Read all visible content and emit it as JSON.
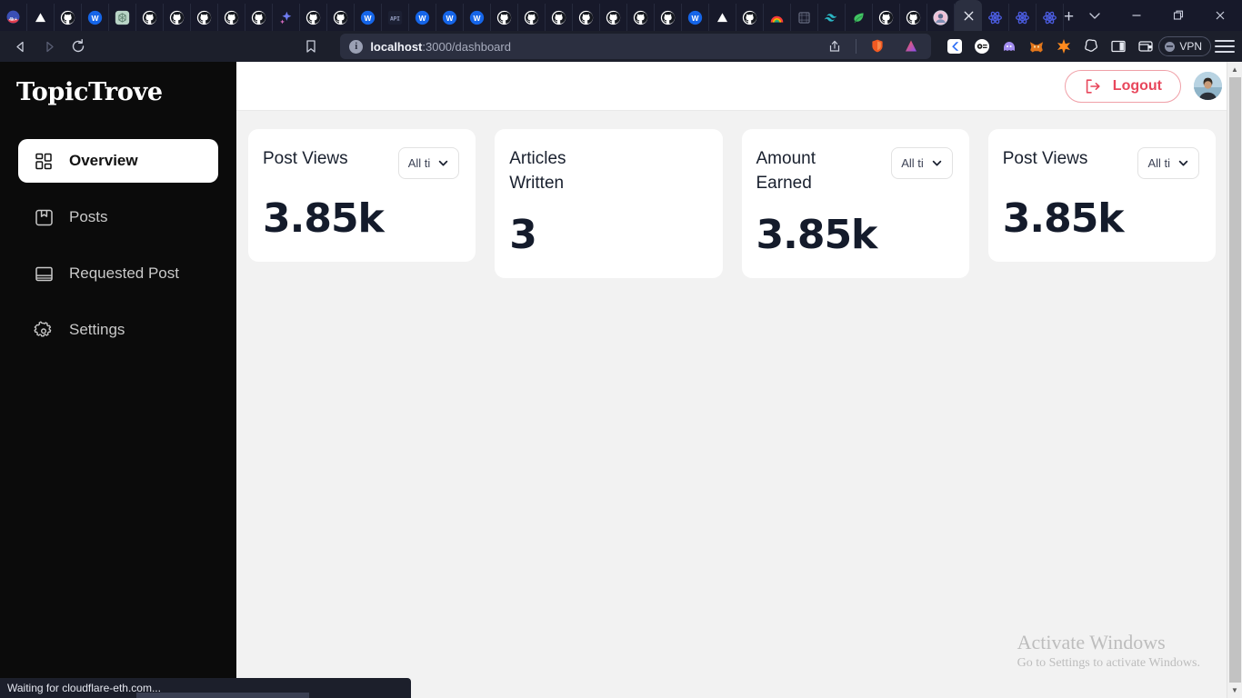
{
  "browser": {
    "tabs": [
      {
        "name": "notification-badge-tab",
        "icon": "badge-4k",
        "active": false
      },
      {
        "name": "triangle-tab",
        "icon": "triangle",
        "active": false
      },
      {
        "name": "github-tab",
        "icon": "github",
        "active": false
      },
      {
        "name": "w-tab",
        "icon": "w-circle",
        "active": false
      },
      {
        "name": "openai-tab",
        "icon": "openai",
        "active": false
      },
      {
        "name": "github-tab",
        "icon": "github",
        "active": false
      },
      {
        "name": "github-tab",
        "icon": "github",
        "active": false
      },
      {
        "name": "github-tab",
        "icon": "github",
        "active": false
      },
      {
        "name": "github-tab",
        "icon": "github",
        "active": false
      },
      {
        "name": "github-tab",
        "icon": "github",
        "active": false
      },
      {
        "name": "sparkle-tab",
        "icon": "sparkle",
        "active": false
      },
      {
        "name": "github-tab",
        "icon": "github",
        "active": false
      },
      {
        "name": "github-tab",
        "icon": "github",
        "active": false
      },
      {
        "name": "w-tab",
        "icon": "w-circle",
        "active": false
      },
      {
        "name": "api-tab",
        "icon": "api",
        "active": false
      },
      {
        "name": "w-tab",
        "icon": "w-circle",
        "active": false
      },
      {
        "name": "w-tab",
        "icon": "w-circle",
        "active": false
      },
      {
        "name": "w-tab",
        "icon": "w-circle",
        "active": false
      },
      {
        "name": "github-tab",
        "icon": "github",
        "active": false
      },
      {
        "name": "github-tab",
        "icon": "github",
        "active": false
      },
      {
        "name": "github-tab",
        "icon": "github",
        "active": false
      },
      {
        "name": "github-tab",
        "icon": "github",
        "active": false
      },
      {
        "name": "github-tab",
        "icon": "github",
        "active": false
      },
      {
        "name": "github-tab",
        "icon": "github",
        "active": false
      },
      {
        "name": "github-tab",
        "icon": "github",
        "active": false
      },
      {
        "name": "w-tab",
        "icon": "w-circle",
        "active": false
      },
      {
        "name": "triangle-tab",
        "icon": "triangle",
        "active": false
      },
      {
        "name": "github-tab",
        "icon": "github",
        "active": false
      },
      {
        "name": "rainbow-tab",
        "icon": "rainbow",
        "active": false
      },
      {
        "name": "frame-tab",
        "icon": "frame",
        "active": false
      },
      {
        "name": "tailwind-tab",
        "icon": "tailwind",
        "active": false
      },
      {
        "name": "leaf-tab",
        "icon": "leaf",
        "active": false
      },
      {
        "name": "github-tab",
        "icon": "github",
        "active": false
      },
      {
        "name": "github-tab",
        "icon": "github",
        "active": false
      },
      {
        "name": "avatar-tab",
        "icon": "avatar",
        "active": false
      },
      {
        "name": "dashboard-tab",
        "icon": "close",
        "active": true
      },
      {
        "name": "react-tab",
        "icon": "react",
        "active": false
      },
      {
        "name": "react-tab",
        "icon": "react",
        "active": false
      },
      {
        "name": "react-tab",
        "icon": "react",
        "active": false
      }
    ],
    "new_tab_label": "+",
    "window_controls": {
      "vertical_tabs_label": "⌄",
      "minimize_label": "—",
      "maximize_label": "❐",
      "close_label": "✕"
    },
    "nav": {
      "back_label": "◁",
      "forward_label": "▷",
      "reload_label": "⟳",
      "bookmark_label": "bookmark"
    },
    "omnibox": {
      "info_label": "i",
      "url_host": "localhost",
      "url_path": ":3000/dashboard",
      "share_label": "share"
    },
    "extensions": [
      {
        "name": "kite-extension",
        "label": "K"
      },
      {
        "name": "olympus-extension",
        "label": "OM"
      },
      {
        "name": "phantom-extension",
        "label": "ghost"
      },
      {
        "name": "metamask-extension",
        "label": "fox"
      },
      {
        "name": "starburst-extension",
        "label": "star"
      },
      {
        "name": "blob-extension",
        "label": "blob"
      },
      {
        "name": "sidebar-toggle",
        "label": "panel"
      },
      {
        "name": "wallet-extension",
        "label": "wallet"
      }
    ],
    "vpn_label": "VPN",
    "menu_label": "menu"
  },
  "app": {
    "logo": "TopicTrove",
    "sidebar": {
      "items": [
        {
          "label": "Overview",
          "icon": "grid-icon",
          "active": true
        },
        {
          "label": "Posts",
          "icon": "archive-icon",
          "active": false
        },
        {
          "label": "Requested Post",
          "icon": "book-icon",
          "active": false
        },
        {
          "label": "Settings",
          "icon": "gear-icon",
          "active": false
        }
      ]
    },
    "topbar": {
      "logout_label": "Logout",
      "avatar_alt": "User avatar"
    },
    "cards": [
      {
        "title": "Post Views",
        "value": "3.85k",
        "filter": "All ti",
        "has_filter": true
      },
      {
        "title": "Articles Written",
        "value": "3",
        "filter": "",
        "has_filter": false
      },
      {
        "title": "Amount Earned",
        "value": "3.85k",
        "filter": "All ti",
        "has_filter": true
      },
      {
        "title": "Post Views",
        "value": "3.85k",
        "filter": "All ti",
        "has_filter": true
      }
    ],
    "watermark": {
      "line1": "Activate Windows",
      "line2": "Go to Settings to activate Windows."
    }
  },
  "statusbar": {
    "text": "Waiting for cloudflare-eth.com..."
  },
  "colors": {
    "sidebar_bg": "#0b0b0b",
    "content_bg": "#f2f2f2",
    "accent_logout": "#e8475c",
    "card_bg": "#ffffff",
    "value_text": "#141b2b"
  }
}
